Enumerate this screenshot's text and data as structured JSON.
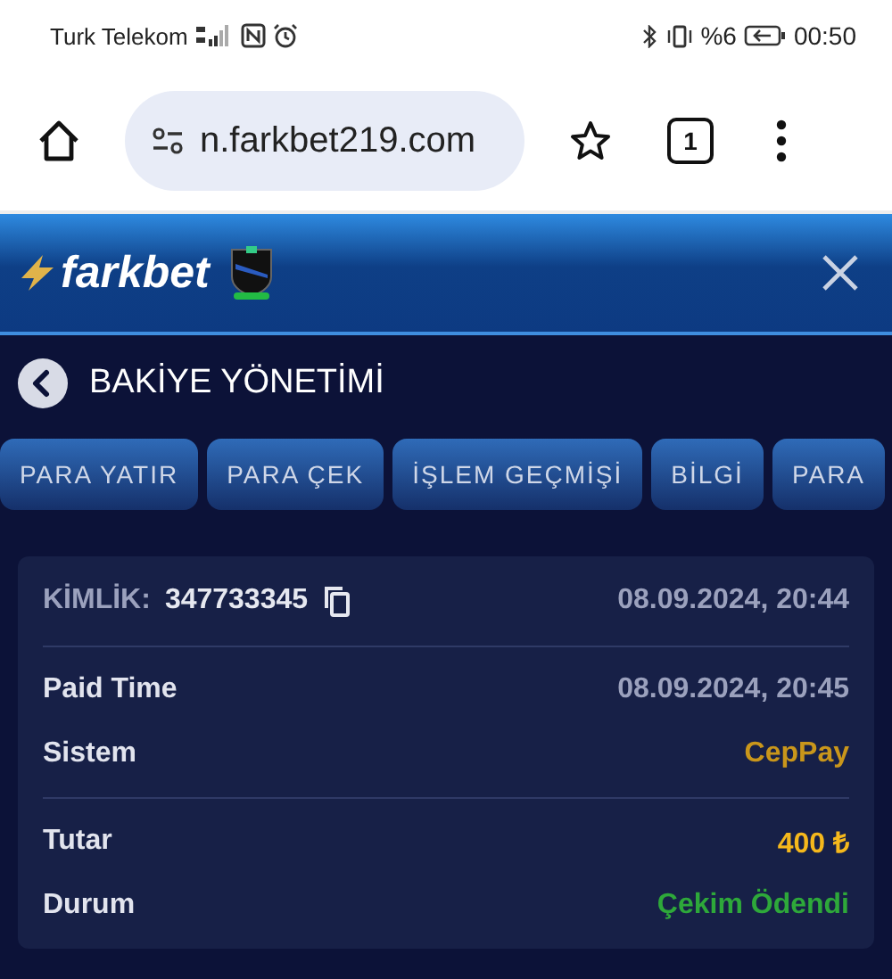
{
  "status_bar": {
    "carrier": "Turk Telekom",
    "battery": "%6",
    "time": "00:50"
  },
  "browser": {
    "url": "n.farkbet219.com",
    "tab_count": "1"
  },
  "header": {
    "logo": "farkbet"
  },
  "page": {
    "title": "BAKİYE YÖNETİMİ"
  },
  "tabs": [
    {
      "label": "PARA YATIR"
    },
    {
      "label": "PARA ÇEK"
    },
    {
      "label": "İŞLEM GEÇMİŞİ"
    },
    {
      "label": "BİLGİ"
    },
    {
      "label": "PARA"
    }
  ],
  "transaction": {
    "id_label": "KİMLİK:",
    "id": "347733345",
    "date": "08.09.2024, 20:44",
    "sections": [
      [
        {
          "label": "Paid Time",
          "value": "08.09.2024, 20:45",
          "color": "#9ba1bd"
        },
        {
          "label": "Sistem",
          "value": "CepPay",
          "color": "#c9961b"
        }
      ],
      [
        {
          "label": "Tutar",
          "value": "400 ₺",
          "color": "#f5b81c"
        },
        {
          "label": "Durum",
          "value": "Çekim Ödendi",
          "color": "#2ea83a"
        }
      ]
    ]
  }
}
